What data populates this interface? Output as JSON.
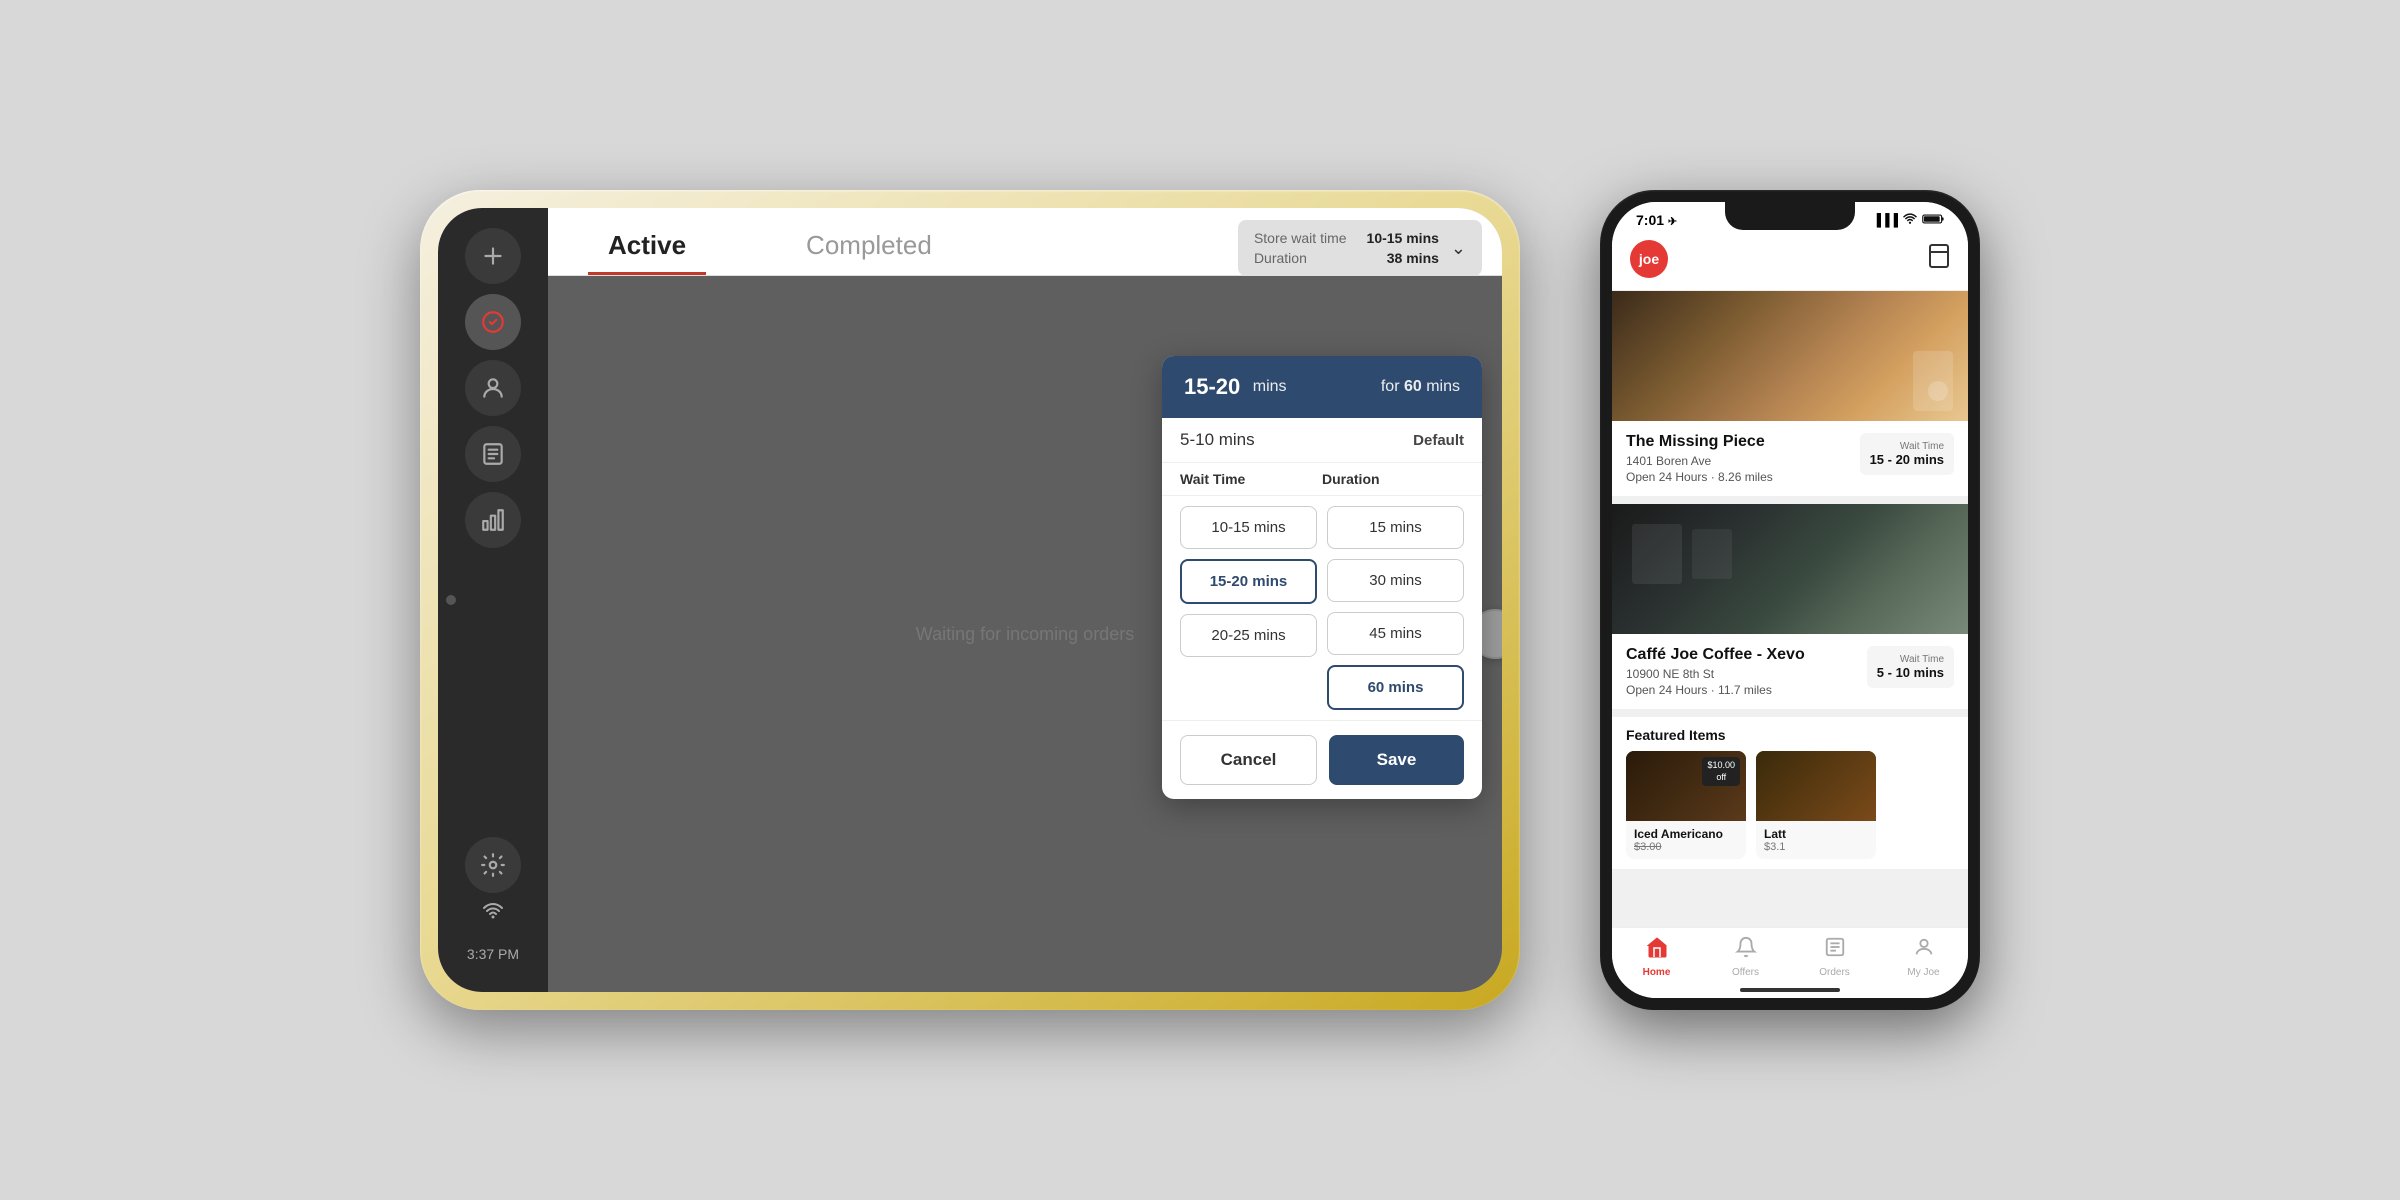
{
  "scene": {
    "background": "#d8d8d8"
  },
  "tablet": {
    "tabs": [
      {
        "id": "active",
        "label": "Active",
        "active": true
      },
      {
        "id": "completed",
        "label": "Completed",
        "active": false
      }
    ],
    "store_info": {
      "wait_time_label": "Store wait time",
      "wait_time_value": "10-15 mins",
      "duration_label": "Duration",
      "duration_value": "38 mins"
    },
    "waiting_text": "Waiting for incoming orders",
    "time": "3:37 PM",
    "modal": {
      "header": {
        "range": "15-20",
        "range_unit": "mins",
        "for_label": "for",
        "duration": "60",
        "duration_unit": "mins"
      },
      "default_row": {
        "range": "5-10 mins",
        "label": "Default"
      },
      "columns": {
        "wait_time_header": "Wait Time",
        "duration_header": "Duration"
      },
      "wait_time_options": [
        {
          "value": "10-15 mins",
          "selected": false
        },
        {
          "value": "15-20 mins",
          "selected": true
        },
        {
          "value": "20-25 mins",
          "selected": false
        }
      ],
      "duration_options": [
        {
          "value": "15 mins",
          "selected": false
        },
        {
          "value": "30 mins",
          "selected": false
        },
        {
          "value": "45 mins",
          "selected": false
        },
        {
          "value": "60 mins",
          "selected": true
        }
      ],
      "cancel_label": "Cancel",
      "save_label": "Save"
    }
  },
  "phone": {
    "status_bar": {
      "time": "7:01",
      "signal": "●●●",
      "wifi": "wifi",
      "battery": "battery"
    },
    "header": {
      "logo_text": "joe",
      "bookmark_icon": "🔖"
    },
    "venues": [
      {
        "id": "v1",
        "name": "The Missing Piece",
        "address": "1401 Boren Ave",
        "hours": "Open 24 Hours · 8.26 miles",
        "wait_time_label": "Wait Time",
        "wait_time_value": "15 - 20 mins",
        "image_type": "coffee"
      },
      {
        "id": "v2",
        "name": "Caffé Joe Coffee - Xevo",
        "address": "10900 NE 8th St",
        "hours": "Open 24 Hours · 11.7 miles",
        "wait_time_label": "Wait Time",
        "wait_time_value": "5 - 10 mins",
        "image_type": "cafe"
      }
    ],
    "featured": {
      "title": "Featured Items",
      "items": [
        {
          "name": "Iced Americano",
          "price": "$3.00",
          "discount": "$10.00\noff",
          "original_price": "$3.00"
        },
        {
          "name": "Latt",
          "price": "$3.1",
          "discount": null
        }
      ]
    },
    "bottom_nav": [
      {
        "id": "home",
        "label": "Home",
        "icon": "🏠",
        "active": true
      },
      {
        "id": "offers",
        "label": "Offers",
        "icon": "🔔",
        "active": false
      },
      {
        "id": "orders",
        "label": "Orders",
        "icon": "📋",
        "active": false
      },
      {
        "id": "my_joe",
        "label": "My Joe",
        "icon": "👤",
        "active": false
      }
    ]
  }
}
